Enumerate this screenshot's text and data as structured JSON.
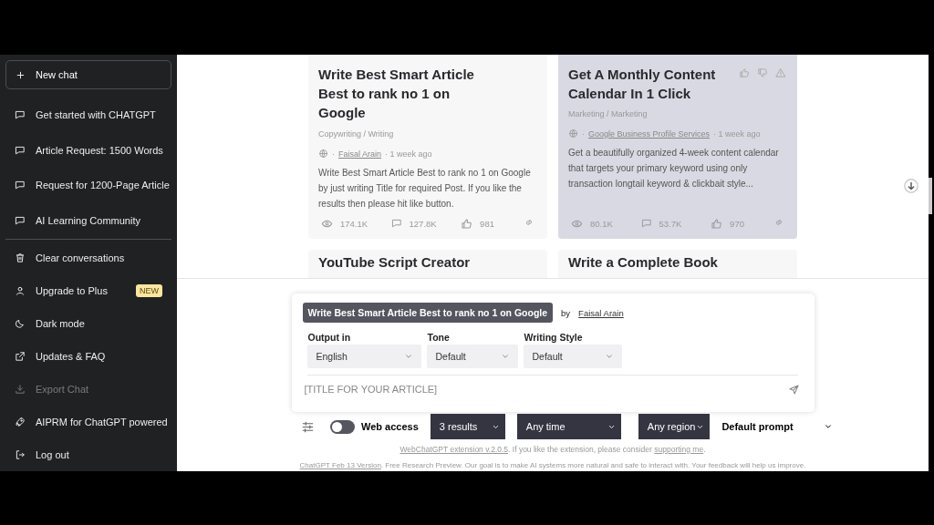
{
  "sidebar": {
    "new_chat": "New chat",
    "chats": [
      {
        "label": "Get started with CHATGPT"
      },
      {
        "label": "Article Request: 1500 Words"
      },
      {
        "label": "Request for 1200-Page Article"
      },
      {
        "label": "AI Learning Community"
      }
    ],
    "actions": [
      {
        "label": "Clear conversations",
        "kind": "trash",
        "disabled": false
      },
      {
        "label": "Upgrade to Plus",
        "kind": "user",
        "badge": "NEW",
        "disabled": false
      },
      {
        "label": "Dark mode",
        "kind": "moon",
        "disabled": false
      },
      {
        "label": "Updates & FAQ",
        "kind": "external",
        "disabled": false
      },
      {
        "label": "Export Chat",
        "kind": "download",
        "disabled": true
      },
      {
        "label": "AIPRM for ChatGPT powered",
        "kind": "rocket",
        "disabled": false
      },
      {
        "label": "Log out",
        "kind": "logout",
        "disabled": false
      }
    ]
  },
  "cards": [
    {
      "title": "Write Best Smart Article Best to rank no 1 on Google",
      "category": "Copywriting / Writing",
      "author": "Faisal Arain",
      "separator": "·",
      "time": "· 1 week ago",
      "description": "Write Best Smart Article Best to rank no 1 on Google by just writing Title for required Post. If you like the results then please hit like button.",
      "views": "174.1K",
      "comments": "127.8K",
      "likes": "981",
      "hovered": false
    },
    {
      "title": "Get A Monthly Content Calendar In 1 Click",
      "category": "Marketing / Marketing",
      "author": "Google Business Profile Services",
      "separator": "·",
      "time": "· 1 week ago",
      "description": "Get a beautifully organized 4-week content calendar that targets your primary keyword using only transaction longtail keyword & clickbait style...",
      "views": "80.1K",
      "comments": "53.7K",
      "likes": "970",
      "hovered": true
    }
  ],
  "more_cards": [
    {
      "title": "YouTube Script Creator"
    },
    {
      "title": "Write a Complete Book"
    }
  ],
  "prompt": {
    "title": "Write Best Smart Article Best to rank no 1 on Google",
    "by": "by",
    "author": "Faisal Arain",
    "options": [
      {
        "label": "Output in",
        "value": "English"
      },
      {
        "label": "Tone",
        "value": "Default"
      },
      {
        "label": "Writing Style",
        "value": "Default"
      }
    ],
    "placeholder": "[TITLE FOR YOUR ARTICLE]"
  },
  "toolbar": {
    "web_access": {
      "label": "Web access",
      "on": false
    },
    "selects": [
      {
        "value": "3 results"
      },
      {
        "value": "Any time"
      },
      {
        "value": "Any region"
      }
    ],
    "default_prompt": "Default prompt"
  },
  "footer": {
    "extension_link": "WebChatGPT extension v.2.0.5",
    "extension_text": ". If you like the extension, please consider ",
    "support_link": "supporting me",
    "extension_end": ".",
    "version_link": "ChatGPT Feb 13 Version",
    "version_text": ". Free Research Preview. Our goal is to make AI systems more natural and safe to interact with. Your feedback will help us improve."
  }
}
